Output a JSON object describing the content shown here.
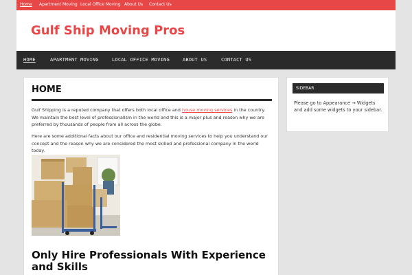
{
  "topbar": {
    "items": [
      {
        "label": "Home"
      },
      {
        "label": "Apartment Moving"
      },
      {
        "label": "Local Office Moving"
      },
      {
        "label": "About Us"
      },
      {
        "label": "Contact Us"
      }
    ],
    "color": "#e84747"
  },
  "header": {
    "site_title": "Gulf Ship Moving Pros"
  },
  "mainnav": {
    "items": [
      {
        "label": "HOME"
      },
      {
        "label": "APARTMENT MOVING"
      },
      {
        "label": "LOCAL OFFICE MOVING"
      },
      {
        "label": "ABOUT US"
      },
      {
        "label": "CONTACT US"
      }
    ]
  },
  "main": {
    "title": "HOME",
    "p1_before": "Gulf Shipping is a reputed company that offers both local office and ",
    "p1_link": "house moving services",
    "p1_after": " in the country. We maintain the best level of professionalism in the world and this is a major plus and reason why we are preferred by thousands of people from all across the globe.",
    "p2": "Here are some additional facts about our office and residential moving services to help you understand our concept and the reason why we are considered the most skilled and professional company in the world today.",
    "heading2": "Only Hire Professionals With Experience and Skills"
  },
  "sidebar": {
    "widget_title": "SIDEBAR",
    "widget_text": "Please go to Appearance → Widgets and add some widgets to your sidebar."
  }
}
